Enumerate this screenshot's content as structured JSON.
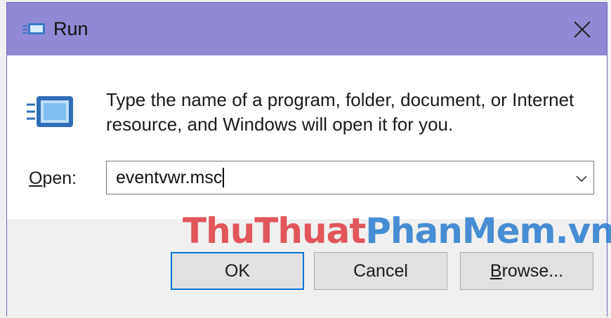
{
  "titlebar": {
    "title": "Run",
    "icon": "run-icon",
    "close_icon": "close-icon"
  },
  "dialog": {
    "description_line1": "Type the name of a program, folder, document, or Internet",
    "description_line2": "resource, and Windows will open it for you.",
    "open_label_mnemonic": "O",
    "open_label_rest": "pen:",
    "open_value": "eventvwr.msc"
  },
  "buttons": {
    "ok": "OK",
    "cancel": "Cancel",
    "browse_mnemonic": "B",
    "browse_rest": "rowse..."
  },
  "watermark": {
    "part1": "ThuThuat",
    "part2": "PhanMem.vn"
  },
  "colors": {
    "titlebar": "#9189d6",
    "accent_border": "#0a74d8",
    "watermark_red": "#e04048",
    "watermark_blue": "#2f80d0"
  }
}
